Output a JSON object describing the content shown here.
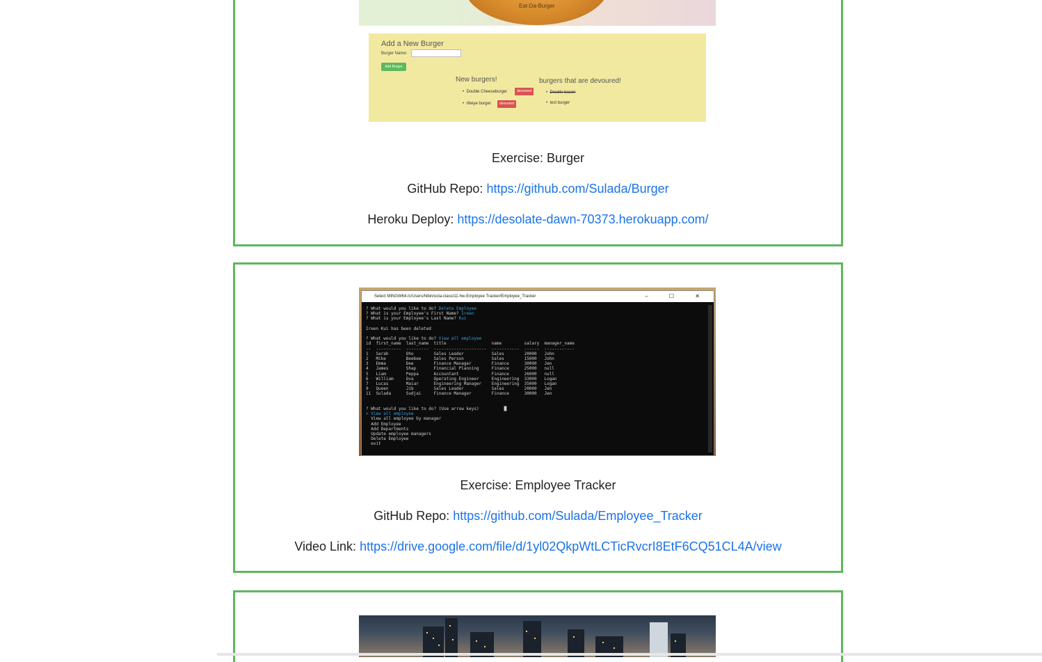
{
  "projects": [
    {
      "exercise_label": "Exercise: Burger",
      "repo_prefix": "GitHub Repo:",
      "repo_url": "https://github.com/Sulada/Burger",
      "link2_prefix": "Heroku Deploy:",
      "link2_url": "https://desolate-dawn-70373.herokuapp.com/",
      "screenshot": {
        "header_text": "Eat-Da-Burger",
        "form_title": "Add a New Burger",
        "field_label": "Burger Name:",
        "add_button": "Add Burger",
        "new_title": "New burgers!",
        "devoured_title": "burgers that are devoured!",
        "new_items": [
          "Double Cheeseburger",
          "ribeye burger"
        ],
        "devour_button": "devoured",
        "devoured_items": [
          "Double bacon",
          "test burger"
        ]
      }
    },
    {
      "exercise_label": "Exercise: Employee Tracker",
      "repo_prefix": "GitHub Repo:",
      "repo_url": "https://github.com/Sulada/Employee_Tracker",
      "link2_prefix": "Video Link:",
      "link2_url": "https://drive.google.com/file/d/1yl02QkpWtLCTicRvcrI8EtF6CQ51CL4A/view",
      "screenshot": {
        "window_title": "Select MINGW64:/c/Users/hibin/ucla-class/11-hw-Employee Tracker/Employee_Tracker",
        "window_controls": "–  ☐  ✕"
      }
    }
  ],
  "colors": {
    "card_border": "#5cb85c",
    "link": "#1a73e8"
  }
}
